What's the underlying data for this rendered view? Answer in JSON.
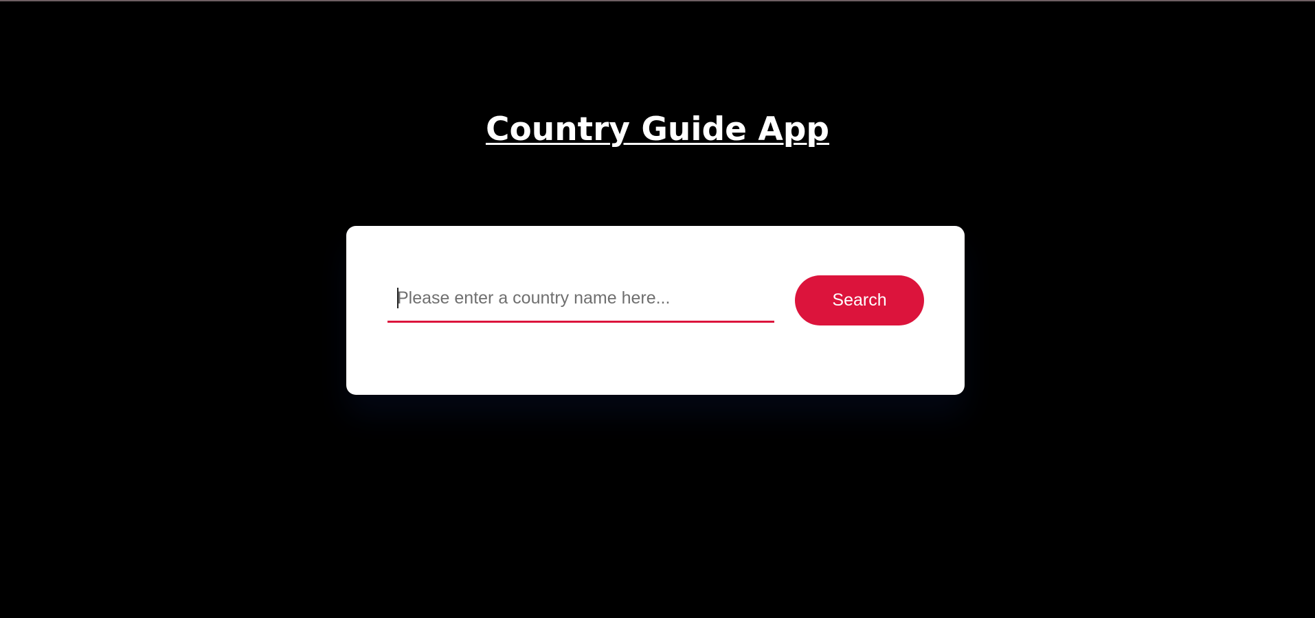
{
  "app": {
    "title": "Country Guide App"
  },
  "search": {
    "placeholder": "Please enter a country name here...",
    "value": "",
    "button_label": "Search"
  },
  "colors": {
    "background": "#000000",
    "card": "#ffffff",
    "accent": "#dc143c",
    "title": "#ffffff"
  }
}
